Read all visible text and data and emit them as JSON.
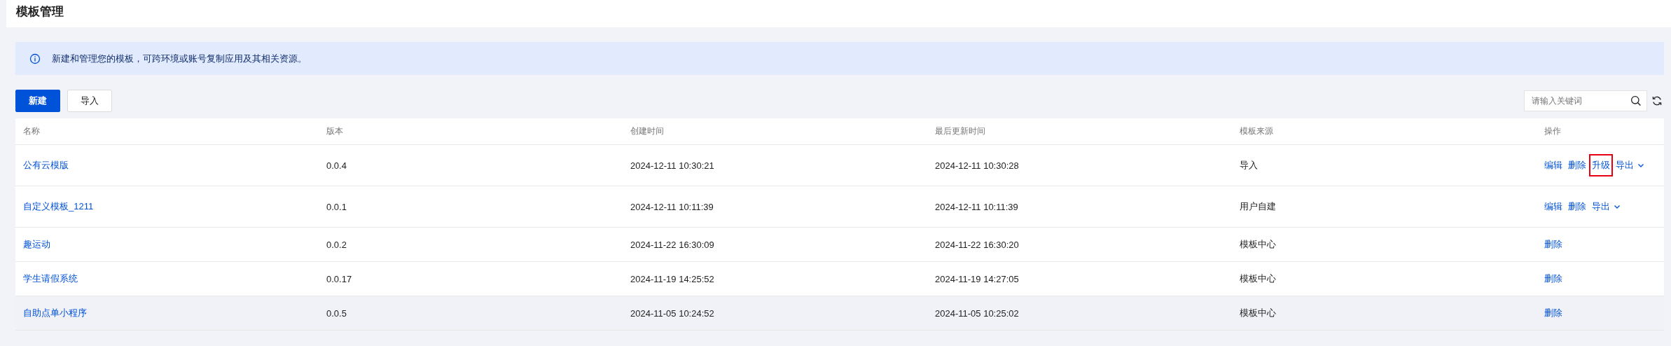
{
  "page_title": "模板管理",
  "notice": "新建和管理您的模板，可跨环境或账号复制应用及其相关资源。",
  "toolbar": {
    "buttons": [
      {
        "label": "新建",
        "kind": "primary"
      },
      {
        "label": "导入",
        "kind": "default"
      }
    ],
    "search": {
      "placeholder": "请输入关键词"
    }
  },
  "table": {
    "columns": [
      "名称",
      "版本",
      "创建时间",
      "最后更新时间",
      "模板来源",
      "操作"
    ],
    "rows": [
      {
        "name": "公有云模版",
        "version": "0.0.4",
        "created": "2024-12-11 10:30:21",
        "updated": "2024-12-11 10:30:28",
        "source": "导入",
        "shaded": false,
        "actions": [
          {
            "label": "编辑",
            "kind": "link",
            "highlighted": false
          },
          {
            "label": "删除",
            "kind": "link",
            "highlighted": false
          },
          {
            "label": "升级",
            "kind": "link",
            "highlighted": true
          },
          {
            "label": "导出",
            "kind": "dropdown",
            "highlighted": false
          }
        ]
      },
      {
        "name": "自定义模板_1211",
        "version": "0.0.1",
        "created": "2024-12-11 10:11:39",
        "updated": "2024-12-11 10:11:39",
        "source": "用户自建",
        "shaded": false,
        "actions": [
          {
            "label": "编辑",
            "kind": "link",
            "highlighted": false
          },
          {
            "label": "删除",
            "kind": "link",
            "highlighted": false
          },
          {
            "label": "导出",
            "kind": "dropdown",
            "highlighted": false
          }
        ]
      },
      {
        "name": "趣运动",
        "version": "0.0.2",
        "created": "2024-11-22 16:30:09",
        "updated": "2024-11-22 16:30:20",
        "source": "模板中心",
        "shaded": false,
        "actions": [
          {
            "label": "删除",
            "kind": "link",
            "highlighted": false
          }
        ]
      },
      {
        "name": "学生请假系统",
        "version": "0.0.17",
        "created": "2024-11-19 14:25:52",
        "updated": "2024-11-19 14:27:05",
        "source": "模板中心",
        "shaded": false,
        "actions": [
          {
            "label": "删除",
            "kind": "link",
            "highlighted": false
          }
        ]
      },
      {
        "name": "自助点单小程序",
        "version": "0.0.5",
        "created": "2024-11-05 10:24:52",
        "updated": "2024-11-05 10:25:02",
        "source": "模板中心",
        "shaded": true,
        "actions": [
          {
            "label": "删除",
            "kind": "link",
            "highlighted": false
          }
        ]
      }
    ]
  }
}
